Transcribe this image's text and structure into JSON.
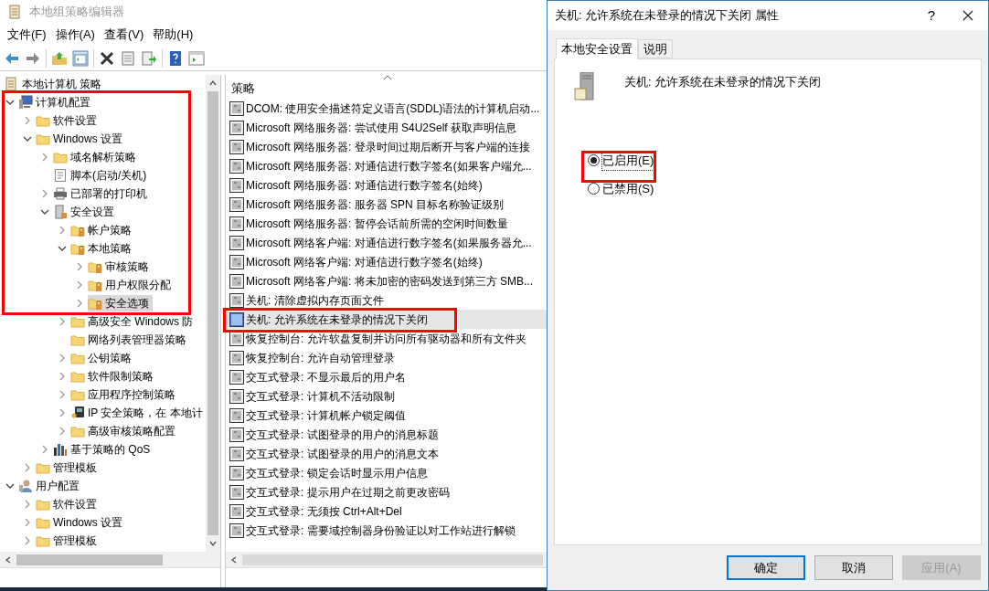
{
  "main_window": {
    "title": "本地组策略编辑器",
    "menu": [
      "文件(F)",
      "操作(A)",
      "查看(V)",
      "帮助(H)"
    ],
    "tree": {
      "root": "本地计算机 策略",
      "items": [
        {
          "label": "计算机配置",
          "kind": "computer",
          "expanded": true,
          "selected": false,
          "children": [
            {
              "label": "软件设置",
              "kind": "folder",
              "expanded": false,
              "selected": false
            },
            {
              "label": "Windows 设置",
              "kind": "folder",
              "expanded": true,
              "selected": false,
              "children": [
                {
                  "label": "域名解析策略",
                  "kind": "folder",
                  "expanded": false,
                  "selected": false
                },
                {
                  "label": "脚本(启动/关机)",
                  "kind": "script",
                  "selected": false
                },
                {
                  "label": "已部署的打印机",
                  "kind": "printer",
                  "expanded": false,
                  "selected": false
                },
                {
                  "label": "安全设置",
                  "kind": "security",
                  "expanded": true,
                  "selected": false,
                  "children": [
                    {
                      "label": "帐户策略",
                      "kind": "lock-folder",
                      "expanded": false,
                      "selected": false
                    },
                    {
                      "label": "本地策略",
                      "kind": "lock-folder",
                      "expanded": true,
                      "selected": false,
                      "children": [
                        {
                          "label": "审核策略",
                          "kind": "lock-folder",
                          "expanded": false,
                          "selected": false
                        },
                        {
                          "label": "用户权限分配",
                          "kind": "lock-folder",
                          "expanded": false,
                          "selected": false
                        },
                        {
                          "label": "安全选项",
                          "kind": "lock-folder",
                          "expanded": false,
                          "selected": true
                        }
                      ]
                    },
                    {
                      "label": "高级安全 Windows 防",
                      "kind": "folder",
                      "expanded": false,
                      "selected": false
                    },
                    {
                      "label": "网络列表管理器策略",
                      "kind": "folder",
                      "selected": false
                    },
                    {
                      "label": "公钥策略",
                      "kind": "folder",
                      "expanded": false,
                      "selected": false
                    },
                    {
                      "label": "软件限制策略",
                      "kind": "folder",
                      "expanded": false,
                      "selected": false
                    },
                    {
                      "label": "应用程序控制策略",
                      "kind": "folder",
                      "expanded": false,
                      "selected": false
                    },
                    {
                      "label": "IP 安全策略，在 本地计",
                      "kind": "ip",
                      "expanded": false,
                      "selected": false
                    },
                    {
                      "label": "高级审核策略配置",
                      "kind": "folder",
                      "expanded": false,
                      "selected": false
                    }
                  ]
                },
                {
                  "label": "基于策略的 QoS",
                  "kind": "qos",
                  "expanded": false,
                  "selected": false
                }
              ]
            },
            {
              "label": "管理模板",
              "kind": "folder",
              "expanded": false,
              "selected": false
            }
          ]
        },
        {
          "label": "用户配置",
          "kind": "user",
          "expanded": true,
          "selected": false,
          "children": [
            {
              "label": "软件设置",
              "kind": "folder",
              "expanded": false,
              "selected": false
            },
            {
              "label": "Windows 设置",
              "kind": "folder",
              "expanded": false,
              "selected": false
            },
            {
              "label": "管理模板",
              "kind": "folder",
              "expanded": false,
              "selected": false
            }
          ]
        }
      ]
    },
    "policy_list": {
      "column": "策略",
      "rows": [
        {
          "name": "DCOM: 使用安全描述符定义语言(SDDL)语法的计算机启动...",
          "selected": false
        },
        {
          "name": "Microsoft 网络服务器: 尝试使用 S4U2Self 获取声明信息",
          "selected": false
        },
        {
          "name": "Microsoft 网络服务器: 登录时间过期后断开与客户端的连接",
          "selected": false
        },
        {
          "name": "Microsoft 网络服务器: 对通信进行数字签名(如果客户端允...",
          "selected": false
        },
        {
          "name": "Microsoft 网络服务器: 对通信进行数字签名(始终)",
          "selected": false
        },
        {
          "name": "Microsoft 网络服务器: 服务器 SPN 目标名称验证级别",
          "selected": false
        },
        {
          "name": "Microsoft 网络服务器: 暂停会话前所需的空闲时间数量",
          "selected": false
        },
        {
          "name": "Microsoft 网络客户端: 对通信进行数字签名(如果服务器允...",
          "selected": false
        },
        {
          "name": "Microsoft 网络客户端: 对通信进行数字签名(始终)",
          "selected": false
        },
        {
          "name": "Microsoft 网络客户端: 将未加密的密码发送到第三方 SMB...",
          "selected": false
        },
        {
          "name": "关机: 清除虚拟内存页面文件",
          "selected": false
        },
        {
          "name": "关机: 允许系统在未登录的情况下关闭",
          "selected": true
        },
        {
          "name": "恢复控制台: 允许软盘复制并访问所有驱动器和所有文件夹",
          "selected": false
        },
        {
          "name": "恢复控制台: 允许自动管理登录",
          "selected": false
        },
        {
          "name": "交互式登录: 不显示最后的用户名",
          "selected": false
        },
        {
          "name": "交互式登录: 计算机不活动限制",
          "selected": false
        },
        {
          "name": "交互式登录: 计算机帐户锁定阈值",
          "selected": false
        },
        {
          "name": "交互式登录: 试图登录的用户的消息标题",
          "selected": false
        },
        {
          "name": "交互式登录: 试图登录的用户的消息文本",
          "selected": false
        },
        {
          "name": "交互式登录: 锁定会话时显示用户信息",
          "selected": false
        },
        {
          "name": "交互式登录: 提示用户在过期之前更改密码",
          "selected": false
        },
        {
          "name": "交互式登录: 无须按 Ctrl+Alt+Del",
          "selected": false
        },
        {
          "name": "交互式登录: 需要域控制器身份验证以对工作站进行解锁",
          "selected": false
        }
      ]
    }
  },
  "dialog": {
    "title": "关机: 允许系统在未登录的情况下关闭 属性",
    "help": "?",
    "tabs": [
      {
        "label": "本地安全设置",
        "selected": true
      },
      {
        "label": "说明",
        "selected": false
      }
    ],
    "policy_name": "关机: 允许系统在未登录的情况下关闭",
    "options": [
      {
        "label": "已启用(E)",
        "selected": true
      },
      {
        "label": "已禁用(S)",
        "selected": false
      }
    ],
    "buttons": [
      {
        "label": "确定",
        "kind": "default"
      },
      {
        "label": "取消",
        "kind": "normal"
      },
      {
        "label": "应用(A)",
        "kind": "disabled"
      }
    ]
  }
}
